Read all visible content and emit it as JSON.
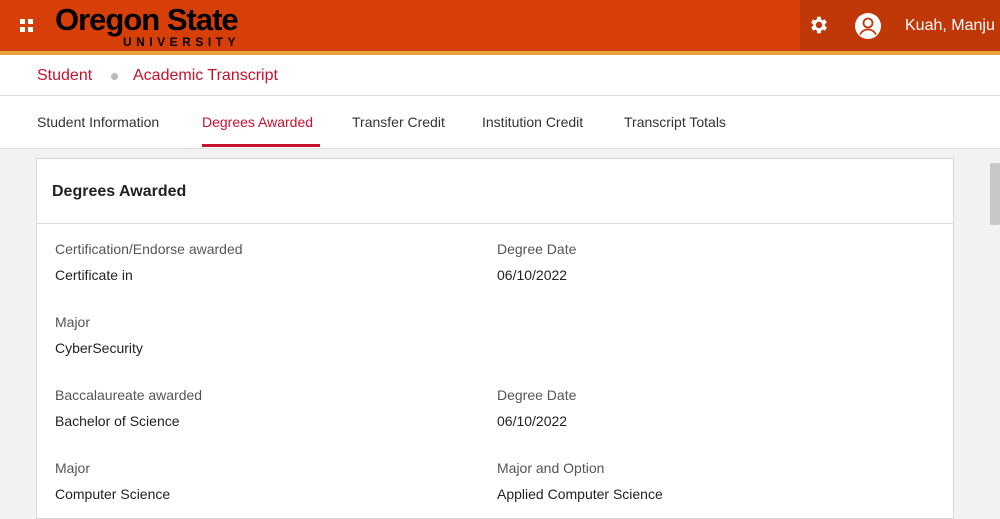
{
  "header": {
    "logo_main": "Oregon State",
    "logo_sub": "UNIVERSITY",
    "user_name": "Kuah, Manju",
    "colors": {
      "brand": "#d73f09",
      "accent": "#c4122f"
    }
  },
  "breadcrumb": {
    "items": [
      "Student",
      "Academic Transcript"
    ]
  },
  "tabs": [
    {
      "label": "Student Information",
      "active": false
    },
    {
      "label": "Degrees Awarded",
      "active": true
    },
    {
      "label": "Transfer Credit",
      "active": false
    },
    {
      "label": "Institution Credit",
      "active": false
    },
    {
      "label": "Transcript Totals",
      "active": false
    }
  ],
  "card": {
    "title": "Degrees Awarded",
    "fields": [
      {
        "label": "Certification/Endorse awarded",
        "value": "Certificate in"
      },
      {
        "label": "Degree Date",
        "value": "06/10/2022"
      },
      {
        "label": "Major",
        "value": "CyberSecurity"
      },
      {
        "label": "Baccalaureate awarded",
        "value": "Bachelor of Science"
      },
      {
        "label": "Degree Date",
        "value": "06/10/2022"
      },
      {
        "label": "Major",
        "value": "Computer Science"
      },
      {
        "label": "Major and Option",
        "value": "Applied Computer Science"
      }
    ]
  },
  "icons": {
    "menu": "grid-icon",
    "settings": "gear-icon",
    "user": "user-icon"
  }
}
